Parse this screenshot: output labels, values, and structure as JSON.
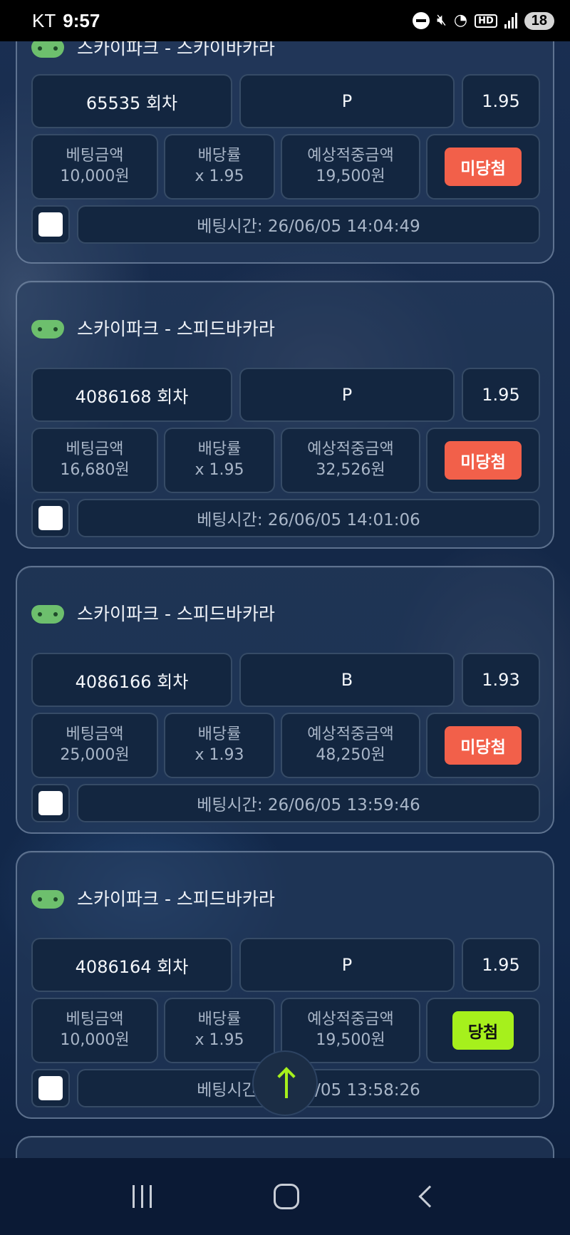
{
  "status_bar": {
    "carrier": "KT",
    "time": "9:57",
    "battery": "18"
  },
  "labels": {
    "bet_amount": "베팅금액",
    "odds": "배당률",
    "expected_win": "예상적중금액"
  },
  "cards": [
    {
      "title": "스카이파크 - 스카이바카라",
      "round": "65535 회차",
      "pick": "P",
      "rate": "1.95",
      "bet_amount": "10,000원",
      "odds": "x 1.95",
      "expected_win": "19,500원",
      "result": "미당첨",
      "bet_time": "베팅시간: 26/06/05 14:04:49"
    },
    {
      "title": "스카이파크 - 스피드바카라",
      "round": "4086168 회차",
      "pick": "P",
      "rate": "1.95",
      "bet_amount": "16,680원",
      "odds": "x 1.95",
      "expected_win": "32,526원",
      "result": "미당첨",
      "bet_time": "베팅시간: 26/06/05 14:01:06"
    },
    {
      "title": "스카이파크 - 스피드바카라",
      "round": "4086166 회차",
      "pick": "B",
      "rate": "1.93",
      "bet_amount": "25,000원",
      "odds": "x 1.93",
      "expected_win": "48,250원",
      "result": "미당첨",
      "bet_time": "베팅시간: 26/06/05 13:59:46"
    },
    {
      "title": "스카이파크 - 스피드바카라",
      "round": "4086164 회차",
      "pick": "P",
      "rate": "1.95",
      "bet_amount": "10,000원",
      "odds": "x 1.95",
      "expected_win": "19,500원",
      "result": "당첨",
      "bet_time": "베팅시간: 26/06/05 13:58:26"
    }
  ],
  "colors": {
    "lose_badge": "#f2604a",
    "win_badge": "#a6f01c",
    "scroll_arrow": "#a6f01c"
  },
  "icons": {
    "card": "gamepad-icon",
    "scroll_top": "arrow-up-icon"
  }
}
